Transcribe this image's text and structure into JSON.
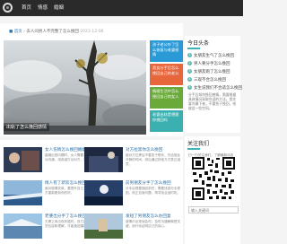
{
  "nav": {
    "items": [
      "首页",
      "情感",
      "婚姻"
    ]
  },
  "breadcrumb": {
    "home": "首页",
    "current": "去人间男人不完整了怎么挽回",
    "date": "2023-12-06"
  },
  "hero": {
    "caption": "出轨了怎么挽回感情"
  },
  "promos": [
    {
      "text": "孩子老公吵了怎么恢复与老婆感情",
      "color": "#2a9ad6"
    },
    {
      "text": "男女分手后怎么挽回自己的老公",
      "color": "#e8663c"
    },
    {
      "text": "情感生活中怎么挽回自己的女人",
      "color": "#6aaa3a"
    },
    {
      "text": "老婆出轨是想跟你挽回吗",
      "color": "#3ab0b0"
    }
  ],
  "sidebar": {
    "title": "今日头条",
    "items": [
      {
        "num": "1",
        "label": "女朋友生气了怎么挽回"
      },
      {
        "num": "2",
        "label": "男人要分手怎么挽回"
      },
      {
        "num": "3",
        "label": "女朋友跑了怎么挽回"
      },
      {
        "num": "4",
        "label": "三观不合怎么挽回"
      },
      {
        "num": "5",
        "label": "女生说我们不合适怎么挽回"
      }
    ],
    "excerpt": "分手后如何挽回感情，需要根据具体情况采取合适的方法。首先要冷静下来，不要急于挽回，给彼此一些空间。"
  },
  "follow": {
    "title": "关注我们",
    "scan_text": "扫一扫关注我们，了解最新动态",
    "search_placeholder": "输入关键词"
  },
  "articles": [
    {
      "title": "女人伤情怎么挽回婚姻",
      "desc": "婚姻出现问题时，女人需要冷静分析原因，主动沟通，用真诚打动对方，重建信任。"
    },
    {
      "title": "对方拉黑你怎么挽回",
      "desc": "被对方拉黑后不要急于联系，先给彼此冷静的时间，然后通过其他方式表达诚意。"
    },
    {
      "title": "情人有了新欢怎么挽回",
      "desc": "面对感情变故，要提升自己，展现魅力，让对方重新看到你的好。"
    },
    {
      "title": "前男朋友分手了怎么挽回",
      "desc": "分手后想要挽回前任，需要找到分手原因，改正自身问题，再寻找合适时机。"
    },
    {
      "title": "老婆出分手了怎么挽回",
      "desc": "夫妻之间出现矛盾时，双方都需要反思，多一些包容和理解，才能挽回婚姻。"
    },
    {
      "title": "发短了男朋友怎么办回复",
      "desc": "感情中出现误会时，及时沟通解释是关键，用行动证明自己的真心。"
    }
  ]
}
